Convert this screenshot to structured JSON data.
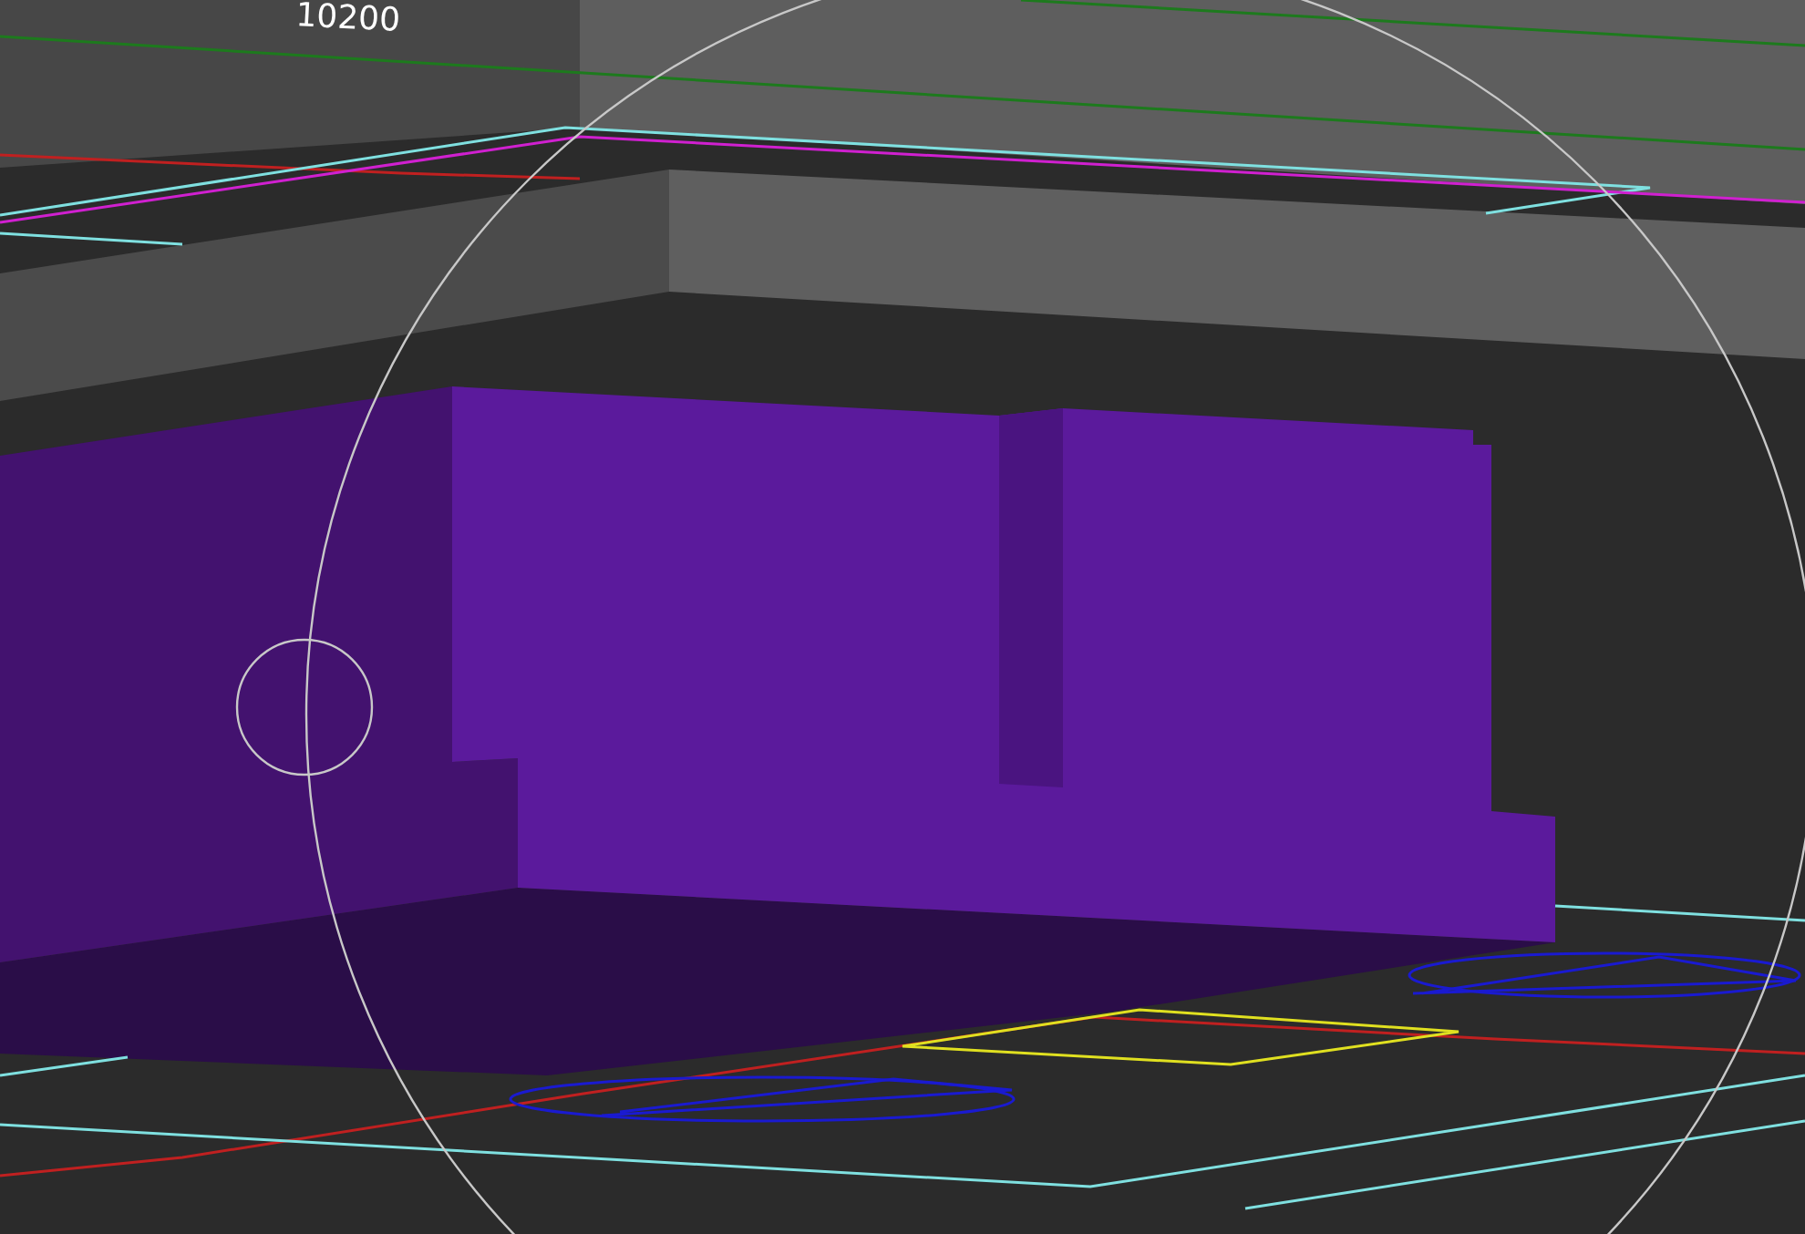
{
  "viewport": {
    "dimension_label": "10200"
  }
}
